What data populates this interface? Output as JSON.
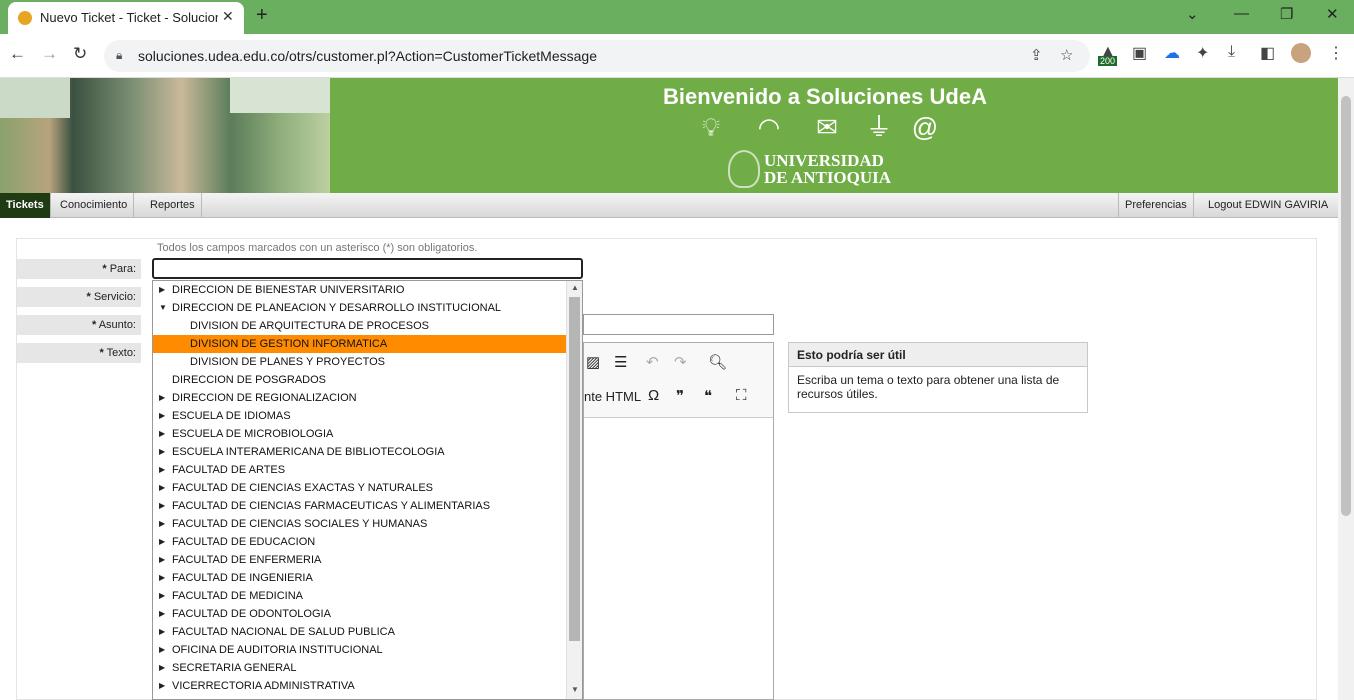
{
  "browser": {
    "tab_title": "Nuevo Ticket - Ticket - Solucione",
    "url": "soluciones.udea.edu.co/otrs/customer.pl?Action=CustomerTicketMessage",
    "extension_badge": "200"
  },
  "banner": {
    "welcome": "Bienvenido a Soluciones UdeA",
    "university_line1": "UNIVERSIDAD",
    "university_line2": "DE ANTIOQUIA"
  },
  "nav": {
    "items": [
      "Tickets",
      "Conocimiento",
      "Reportes"
    ],
    "right": [
      "Preferencias",
      "Logout EDWIN GAVIRIA"
    ],
    "active": "Tickets"
  },
  "form": {
    "required_note": "Todos los campos marcados con un asterisco (*) son obligatorios.",
    "asterisk": "*",
    "labels": [
      "Para:",
      "Servicio:",
      "Asunto:",
      "Texto:"
    ],
    "para_value": "",
    "editor_source_label": "nte HTML"
  },
  "help": {
    "title": "Esto podría ser útil",
    "body": "Escriba un tema o texto para obtener una lista de recursos útiles."
  },
  "dropdown": {
    "items": [
      {
        "label": "DIRECCION DE BIENESTAR UNIVERSITARIO",
        "arrow": "right",
        "indent": 1
      },
      {
        "label": "DIRECCION DE PLANEACION Y DESARROLLO INSTITUCIONAL",
        "arrow": "down",
        "indent": 1
      },
      {
        "label": "DIVISION DE ARQUITECTURA DE PROCESOS",
        "arrow": "",
        "indent": 2
      },
      {
        "label": "DIVISION DE GESTION INFORMATICA",
        "arrow": "",
        "indent": 2,
        "selected": true
      },
      {
        "label": "DIVISION DE PLANES Y PROYECTOS",
        "arrow": "",
        "indent": 2
      },
      {
        "label": "DIRECCION DE POSGRADOS",
        "arrow": "",
        "indent": 1
      },
      {
        "label": "DIRECCION DE REGIONALIZACION",
        "arrow": "right",
        "indent": 1
      },
      {
        "label": "ESCUELA DE IDIOMAS",
        "arrow": "right",
        "indent": 1
      },
      {
        "label": "ESCUELA DE MICROBIOLOGIA",
        "arrow": "right",
        "indent": 1
      },
      {
        "label": "ESCUELA INTERAMERICANA DE BIBLIOTECOLOGIA",
        "arrow": "right",
        "indent": 1
      },
      {
        "label": "FACULTAD DE ARTES",
        "arrow": "right",
        "indent": 1
      },
      {
        "label": "FACULTAD DE CIENCIAS EXACTAS Y NATURALES",
        "arrow": "right",
        "indent": 1
      },
      {
        "label": "FACULTAD DE CIENCIAS FARMACEUTICAS Y ALIMENTARIAS",
        "arrow": "right",
        "indent": 1
      },
      {
        "label": "FACULTAD DE CIENCIAS SOCIALES Y HUMANAS",
        "arrow": "right",
        "indent": 1
      },
      {
        "label": "FACULTAD DE EDUCACION",
        "arrow": "right",
        "indent": 1
      },
      {
        "label": "FACULTAD DE ENFERMERIA",
        "arrow": "right",
        "indent": 1
      },
      {
        "label": "FACULTAD DE INGENIERIA",
        "arrow": "right",
        "indent": 1
      },
      {
        "label": "FACULTAD DE MEDICINA",
        "arrow": "right",
        "indent": 1
      },
      {
        "label": "FACULTAD DE ODONTOLOGIA",
        "arrow": "right",
        "indent": 1
      },
      {
        "label": "FACULTAD NACIONAL DE SALUD PUBLICA",
        "arrow": "right",
        "indent": 1
      },
      {
        "label": "OFICINA DE AUDITORIA INSTITUCIONAL",
        "arrow": "right",
        "indent": 1
      },
      {
        "label": "SECRETARIA GENERAL",
        "arrow": "right",
        "indent": 1
      },
      {
        "label": "VICERRECTORIA ADMINISTRATIVA",
        "arrow": "right",
        "indent": 1
      }
    ]
  },
  "colors": {
    "banner_green": "#70ad47",
    "chrome_green": "#6aaf5f",
    "selected_orange": "#ff8c00",
    "nav_active": "#1f3b14"
  },
  "icons": [
    "lightbulb-icon",
    "wifi-icon",
    "briefcase-icon",
    "plug-icon",
    "at-icon"
  ]
}
